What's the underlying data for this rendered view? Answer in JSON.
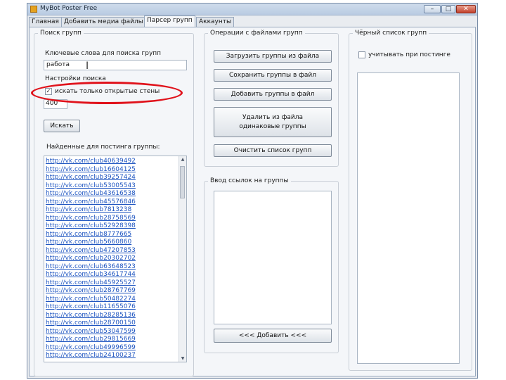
{
  "window": {
    "title": "MyBot Poster Free",
    "controls": [
      "–",
      "□",
      "✕"
    ]
  },
  "tabs": [
    {
      "label": "Главная"
    },
    {
      "label": "Добавить медиа файлы"
    },
    {
      "label": "Парсер групп"
    },
    {
      "label": "Аккаунты"
    }
  ],
  "search": {
    "group_title": "Поиск групп",
    "keywords_label": "Ключевые слова для поиска групп",
    "keywords_value": "работа",
    "settings_label": "Настройки поиска",
    "only_open_walls_label": "искать только открытые стены",
    "only_open_walls_checked": true,
    "count_value": "400",
    "search_button": "Искать",
    "found_label": "Найденные для постинга группы:",
    "results": [
      "http://vk.com/club40639492",
      "http://vk.com/club16604125",
      "http://vk.com/club39257424",
      "http://vk.com/club53005543",
      "http://vk.com/club43616538",
      "http://vk.com/club45576846",
      "http://vk.com/club7813238",
      "http://vk.com/club28758569",
      "http://vk.com/club52928398",
      "http://vk.com/club8777665",
      "http://vk.com/club5660860",
      "http://vk.com/club47207853",
      "http://vk.com/club20302702",
      "http://vk.com/club63648523",
      "http://vk.com/club34617744",
      "http://vk.com/club45925527",
      "http://vk.com/club28767769",
      "http://vk.com/club50482274",
      "http://vk.com/club11655076",
      "http://vk.com/club28285136",
      "http://vk.com/club28700150",
      "http://vk.com/club53047599",
      "http://vk.com/club29815669",
      "http://vk.com/club49996599",
      "http://vk.com/club24100237"
    ]
  },
  "ops": {
    "group_title": "Операции с файлами групп",
    "load_button": "Загрузить группы из файла",
    "save_button": "Сохранить группы в файл",
    "append_button": "Добавить группы в файл",
    "dedupe_button_line1": "Удалить из файла",
    "dedupe_button_line2": "одинаковые группы",
    "clear_button": "Очистить список групп",
    "input_group_title": "Ввод ссылок на группы",
    "add_button": "<<<   Добавить   <<<"
  },
  "blacklist": {
    "group_title": "Чёрный список групп",
    "use_when_posting_label": "учитывать при постинге",
    "use_when_posting_checked": false
  },
  "colors": {
    "accent": "#1d54c0",
    "highlight": "#e0121b"
  }
}
